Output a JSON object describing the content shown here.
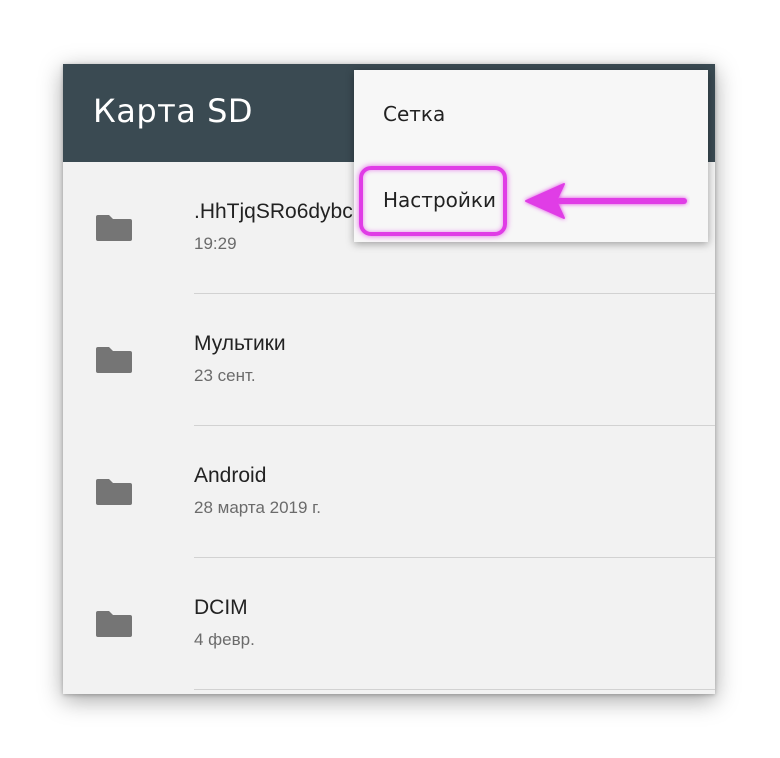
{
  "toolbar": {
    "title": "Карта SD"
  },
  "files": [
    {
      "name": ".HhTjqSRo6dybc",
      "date": "19:29",
      "icon": "folder-icon"
    },
    {
      "name": "Мультики",
      "date": "23 сент.",
      "icon": "folder-icon"
    },
    {
      "name": "Android",
      "date": "28 марта 2019 г.",
      "icon": "folder-icon"
    },
    {
      "name": "DCIM",
      "date": "4 февр.",
      "icon": "folder-icon"
    }
  ],
  "menu": {
    "grid_label": "Сетка",
    "settings_label": "Настройки"
  },
  "colors": {
    "toolbar": "#3a4a52",
    "background": "#f2f2f2",
    "highlight": "#e03ce6",
    "folder": "#757575"
  }
}
